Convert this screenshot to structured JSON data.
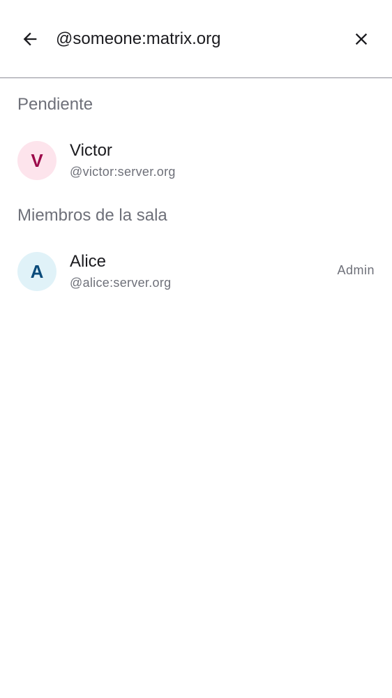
{
  "search": {
    "value": "@someone:matrix.org",
    "back_icon": "arrow-back-icon",
    "clear_icon": "close-icon"
  },
  "sections": {
    "pending": {
      "title": "Pendiente",
      "members": [
        {
          "initial": "V",
          "name": "Victor",
          "user_id": "@victor:server.org",
          "avatar_bg": "#fde4ec",
          "avatar_fg": "#9c0a4a"
        }
      ]
    },
    "room_members": {
      "title": "Miembros de la sala",
      "members": [
        {
          "initial": "A",
          "name": "Alice",
          "user_id": "@alice:server.org",
          "role": "Admin",
          "avatar_bg": "#e0f2f8",
          "avatar_fg": "#0a4b7a"
        }
      ]
    }
  }
}
